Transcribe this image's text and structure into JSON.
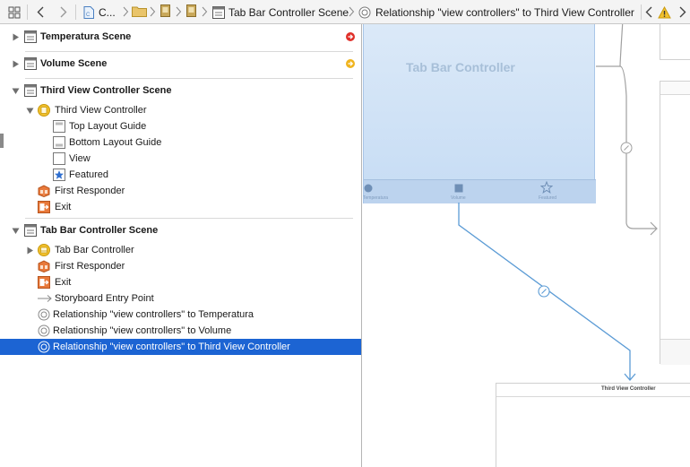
{
  "jumpbar": {
    "crumb_project": "C...",
    "crumb_scene": "Tab Bar Controller Scene",
    "crumb_relationship": "Relationship \"view controllers\" to Third View Controller",
    "icons": [
      "grid-icon",
      "back-arrow-icon",
      "forward-arrow-icon",
      "file-icon",
      "folder-icon",
      "storyboard-icon",
      "storyboard-icon",
      "scene-icon",
      "relationship-icon",
      "issue-back-icon",
      "warning-icon"
    ]
  },
  "outline": {
    "scenes": [
      {
        "label": "Temperatura Scene",
        "status_color": "#e0302a"
      },
      {
        "label": "Volume Scene",
        "status_color": "#f0b41e"
      },
      {
        "label": "Third View Controller Scene"
      },
      {
        "label": "Tab Bar Controller Scene"
      }
    ],
    "third_scene_items": {
      "view_controller": "Third View Controller",
      "top_layout_guide": "Top Layout Guide",
      "bottom_layout_guide": "Bottom Layout Guide",
      "view": "View",
      "featured": "Featured",
      "first_responder": "First Responder",
      "exit": "Exit"
    },
    "tab_scene_items": {
      "tab_bar_controller": "Tab Bar Controller",
      "first_responder": "First Responder",
      "exit": "Exit",
      "entry_point": "Storyboard Entry Point",
      "rel_temperatura": "Relationship \"view controllers\" to Temperatura",
      "rel_volume": "Relationship \"view controllers\" to Volume",
      "rel_third": "Relationship \"view controllers\" to Third View Controller"
    }
  },
  "canvas": {
    "tab_bar_controller_title": "Tab Bar Controller",
    "tab_labels": [
      "Temperatura",
      "Volume",
      "Featured"
    ],
    "third_view_controller_title": "Third View Controller",
    "colors": {
      "selection": "#1c64d3",
      "segue": "#5b9bd5",
      "segue_gray": "#a0a0a0"
    }
  }
}
